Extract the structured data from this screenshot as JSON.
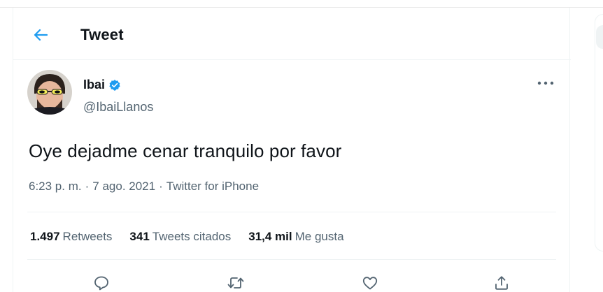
{
  "header": {
    "title": "Tweet",
    "back_icon": "arrow-left-icon"
  },
  "author": {
    "display_name": "Ibai",
    "handle": "@IbaiLlanos",
    "verified": true,
    "avatar_icon": "avatar-image"
  },
  "tweet": {
    "text": "Oye dejadme cenar tranquilo por favor",
    "time": "6:23 p. m.",
    "separator": "·",
    "date": "7 ago. 2021",
    "source": "Twitter for iPhone"
  },
  "stats": [
    {
      "count": "1.497",
      "label": "Retweets"
    },
    {
      "count": "341",
      "label": "Tweets citados"
    },
    {
      "count": "31,4 mil",
      "label": "Me gusta"
    }
  ],
  "actions": {
    "reply_icon": "reply-icon",
    "retweet_icon": "retweet-icon",
    "like_icon": "heart-icon",
    "share_icon": "share-icon",
    "more_icon": "more-horizontal-icon"
  },
  "colors": {
    "accent": "#1d9bf0",
    "text_primary": "#0f1419",
    "text_secondary": "#536471",
    "divider": "#eff3f4"
  }
}
